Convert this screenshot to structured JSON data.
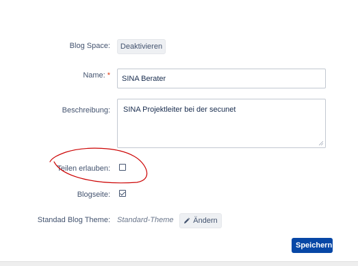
{
  "form": {
    "blog_space": {
      "label": "Blog Space:",
      "button_label": "Deaktivieren"
    },
    "name": {
      "label": "Name:",
      "required_marker": "*",
      "value": "SINA Berater"
    },
    "description": {
      "label": "Beschreibung:",
      "value": "SINA Projektleiter bei der secunet"
    },
    "allow_sharing": {
      "label": "Teilen erlauben:",
      "checked": false
    },
    "blog_page": {
      "label": "Blogseite:",
      "checked": true
    },
    "theme": {
      "label": "Standad Blog Theme:",
      "value": "Standard-Theme",
      "change_label": "Ändern",
      "change_icon": "pencil-icon"
    },
    "save_label": "Speichern"
  },
  "annotation": {
    "color": "#cc0000"
  },
  "colors": {
    "primary": "#0747a6",
    "required": "#de350b"
  }
}
